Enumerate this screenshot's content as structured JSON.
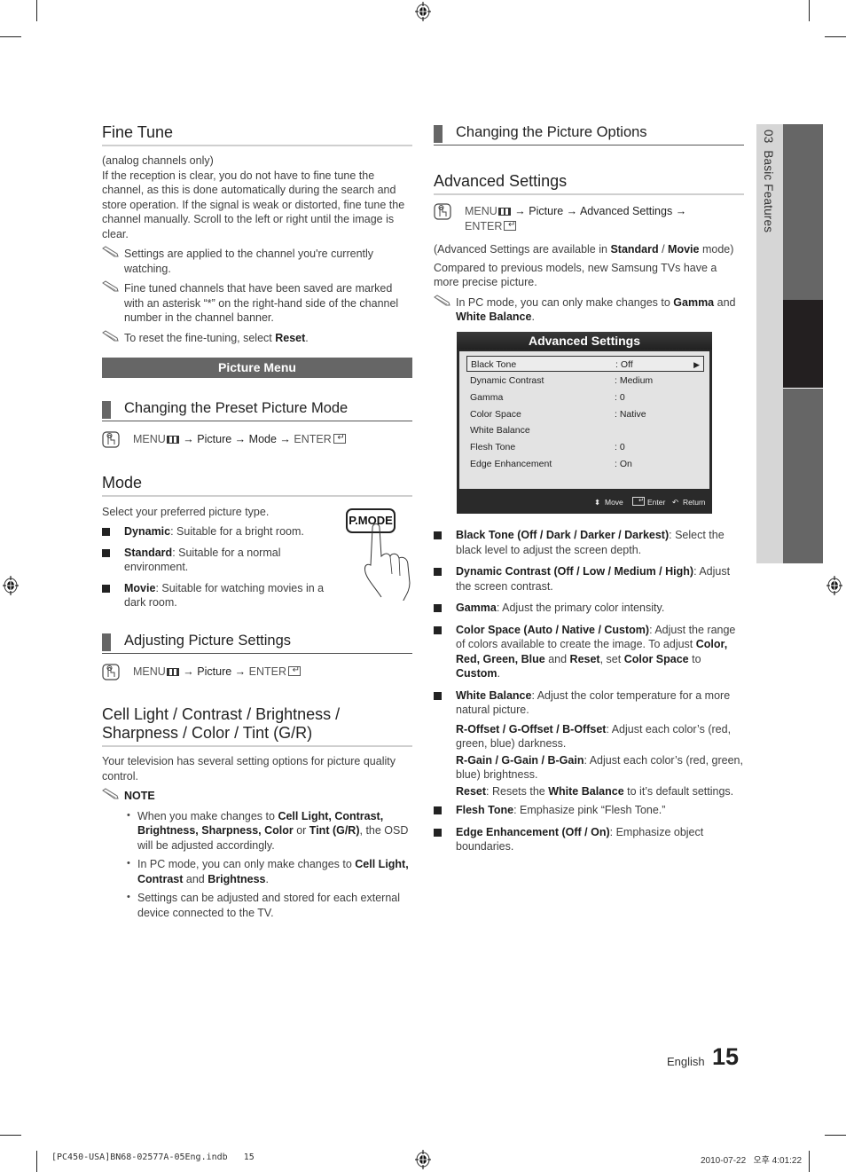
{
  "left": {
    "fine_tune": {
      "title": "Fine Tune",
      "sub": "(analog channels only)",
      "body": "If the reception is clear, you do not have to fine tune the channel, as this is done automatically during the search and store operation. If the signal is weak or distorted, fine tune the channel manually. Scroll to the left or right until the image is clear.",
      "note1": "Settings are applied to the channel you're currently watching.",
      "note2": "Fine tuned channels that have been saved are marked with an asterisk “*” on the right-hand side of the channel number in the channel banner.",
      "note3_pre": "To reset the fine-tuning, select ",
      "note3_bold": "Reset",
      "note3_post": "."
    },
    "picture_menu_banner": "Picture Menu",
    "preset": {
      "title": "Changing the Preset Picture Mode",
      "menu": "MENU",
      "arrow": "→",
      "path1": "Picture",
      "path2": "Mode",
      "enter": "ENTER"
    },
    "mode": {
      "title": "Mode",
      "intro": "Select your preferred picture type.",
      "items": [
        {
          "bold": "Dynamic",
          "text": ": Suitable for a bright room."
        },
        {
          "bold": "Standard",
          "text": ": Suitable for a normal environment."
        },
        {
          "bold": "Movie",
          "text": ": Suitable for watching movies in a dark room."
        }
      ],
      "button_label": "P.MODE"
    },
    "adjusting": {
      "title": "Adjusting Picture Settings",
      "menu": "MENU",
      "arrow": "→",
      "path1": "Picture",
      "enter": "ENTER"
    },
    "cell_light": {
      "title_line1": "Cell Light / Contrast / Brightness /",
      "title_line2": "Sharpness / Color / Tint (G/R)",
      "body": "Your television has several setting options for picture quality control.",
      "note_label": "NOTE",
      "b1_pre": "When you make changes to ",
      "b1_bold1": "Cell Light, Contrast, Brightness, Sharpness, Color",
      "b1_mid": " or ",
      "b1_bold2": "Tint (G/R)",
      "b1_post": ", the OSD will be adjusted accordingly.",
      "b2_pre": "In PC mode, you can only make changes to ",
      "b2_bold1": "Cell Light, Contrast",
      "b2_mid": " and ",
      "b2_bold2": "Brightness",
      "b2_post": ".",
      "b3": "Settings can be adjusted and stored for each external device connected to the TV."
    }
  },
  "right": {
    "options_title": "Changing the Picture Options",
    "adv": {
      "title": "Advanced Settings",
      "menu": "MENU",
      "arrow": "→",
      "path1": "Picture",
      "path2": "Advanced Settings",
      "enter": "ENTER",
      "avail_pre": "(Advanced Settings are available in ",
      "avail_b1": "Standard",
      "avail_mid": " / ",
      "avail_b2": "Movie",
      "avail_post": " mode)",
      "compare": "Compared to previous models, new Samsung TVs have a more precise picture.",
      "pc_pre": "In PC mode, you can only make changes to ",
      "pc_b1": "Gamma",
      "pc_mid": " and ",
      "pc_b2": "White Balance",
      "pc_post": "."
    },
    "osd": {
      "title": "Advanced Settings",
      "rows": [
        {
          "label": "Black Tone",
          "value": ": Off",
          "selected": true
        },
        {
          "label": "Dynamic Contrast",
          "value": ": Medium"
        },
        {
          "label": "Gamma",
          "value": ": 0"
        },
        {
          "label": "Color Space",
          "value": ": Native"
        },
        {
          "label": "White Balance",
          "value": ""
        },
        {
          "label": "Flesh Tone",
          "value": ": 0"
        },
        {
          "label": "Edge Enhancement",
          "value": ": On"
        }
      ],
      "footer": {
        "move": "Move",
        "enter": "Enter",
        "return": "Return"
      }
    },
    "bullets": {
      "b1_bold": "Black Tone (Off / Dark / Darker / Darkest)",
      "b1_text": ": Select the black level to adjust the screen depth.",
      "b2_bold": "Dynamic Contrast (Off / Low / Medium / High)",
      "b2_text": ": Adjust the screen contrast.",
      "b3_bold": "Gamma",
      "b3_text": ": Adjust the primary color intensity.",
      "b4_bold": "Color Space (Auto / Native / Custom)",
      "b4_t1": ": Adjust the range of colors available to create the image. To adjust ",
      "b4_b2": "Color, Red, Green, Blue",
      "b4_t2": " and ",
      "b4_b3": "Reset",
      "b4_t3": ", set ",
      "b4_b4": "Color Space",
      "b4_t4": " to ",
      "b4_b5": "Custom",
      "b4_t5": ".",
      "b5_bold": "White Balance",
      "b5_text": ": Adjust the color temperature for a more natural picture.",
      "wb1_bold": "R-Offset / G-Offset / B-Offset",
      "wb1_text": ": Adjust each color’s (red, green, blue) darkness.",
      "wb2_bold": "R-Gain / G-Gain / B-Gain",
      "wb2_text": ": Adjust each color’s (red, green, blue) brightness.",
      "wb3_bold": "Reset",
      "wb3_t1": ": Resets the ",
      "wb3_b2": "White Balance",
      "wb3_t2": " to it’s default settings.",
      "b6_bold": "Flesh Tone",
      "b6_text": ": Emphasize pink “Flesh Tone.”",
      "b7_bold": "Edge Enhancement (Off / On)",
      "b7_text": ": Emphasize object boundaries."
    }
  },
  "side_tab": {
    "chapter": "03",
    "label": "Basic Features"
  },
  "footer": {
    "language": "English",
    "page_number": "15",
    "file_info": "[PC450-USA]BN68-02577A-05Eng.indb   15",
    "timestamp": "2010-07-22   오후 4:01:22"
  }
}
